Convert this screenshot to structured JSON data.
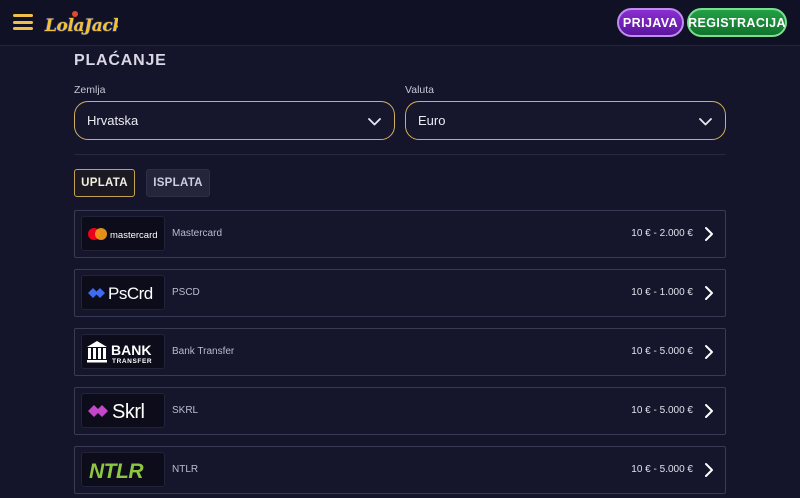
{
  "header": {
    "logo_text": "LolaJack",
    "login_label": "PRIJAVA",
    "register_label": "REGISTRACIJA"
  },
  "payment": {
    "title": "PLAĆANJE",
    "country_label": "Zemlja",
    "country_value": "Hrvatska",
    "currency_label": "Valuta",
    "currency_value": "Euro",
    "tabs": [
      {
        "label": "UPLATA",
        "active": true
      },
      {
        "label": "ISPLATA",
        "active": false
      }
    ],
    "methods": [
      {
        "name": "Mastercard",
        "range": "10 € - 2.000 €",
        "logo_text": "mastercard",
        "icon": "mastercard-icon"
      },
      {
        "name": "PSCD",
        "range": "10 € - 1.000 €",
        "logo_text": "PsCrd",
        "icon": "pscrd-icon"
      },
      {
        "name": "Bank Transfer",
        "range": "10 € - 5.000 €",
        "logo_text": "BANK",
        "logo_subtext": "TRANSFER",
        "icon": "bank-icon"
      },
      {
        "name": "SKRL",
        "range": "10 € - 5.000 €",
        "logo_text": "Skrl",
        "icon": "skrill-icon"
      },
      {
        "name": "NTLR",
        "range": "10 € - 5.000 €",
        "logo_text": "NTLR",
        "icon": "neteller-icon"
      }
    ]
  },
  "colors": {
    "background": "#14142a",
    "accent_gold": "#d4ae5e",
    "login_purple": "#7a25c2",
    "register_green": "#1c8d3c"
  }
}
